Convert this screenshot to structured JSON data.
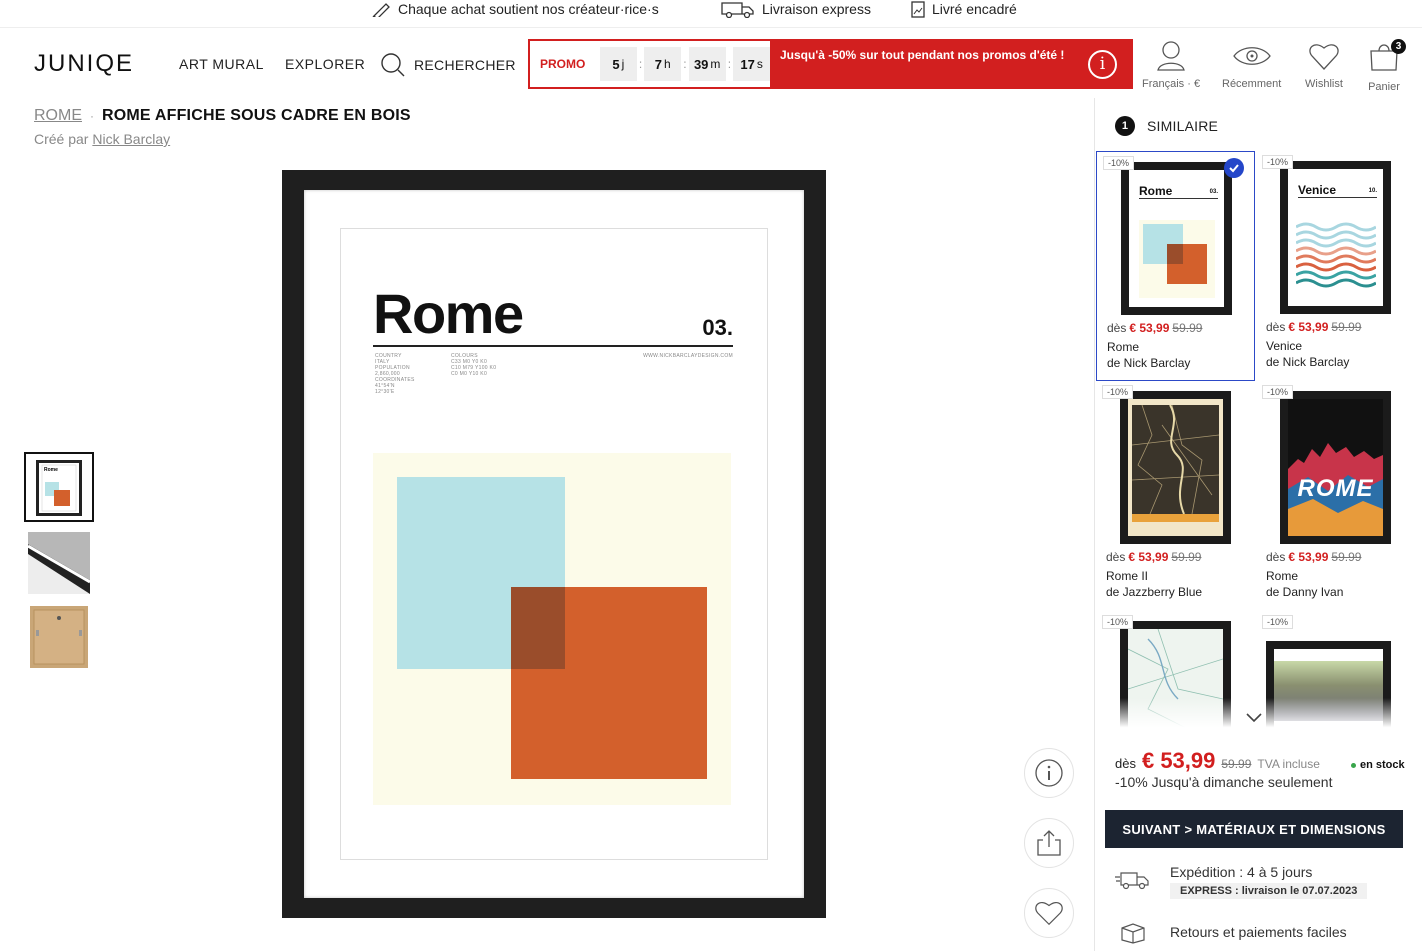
{
  "topbar": {
    "items": [
      "Chaque achat soutient nos créateur·rice·s",
      "Livraison express",
      "Livré encadré"
    ]
  },
  "header": {
    "logo": "JUNIQE",
    "nav": [
      "ART MURAL",
      "EXPLORER"
    ],
    "search_label": "RECHERCHER",
    "promo": {
      "label": "PROMO",
      "countdown": [
        {
          "value": "5",
          "unit": "j"
        },
        {
          "value": "7",
          "unit": "h"
        },
        {
          "value": "39",
          "unit": "m"
        },
        {
          "value": "17",
          "unit": "s"
        }
      ],
      "text": "Jusqu'à -50% sur tout pendant nos promos d'été !",
      "info_glyph": "i"
    },
    "icons": {
      "account_label": "Français · €",
      "recent_label": "Récemment",
      "wishlist_label": "Wishlist",
      "cart_label": "Panier",
      "cart_count": "3"
    }
  },
  "breadcrumb": {
    "parent": "ROME",
    "current": "ROME AFFICHE SOUS CADRE EN BOIS"
  },
  "creator": {
    "prefix": "Créé par",
    "name": "Nick Barclay"
  },
  "poster": {
    "title": "Rome",
    "number": "03.",
    "meta_left": [
      "COUNTRY",
      "ITALY",
      "POPULATION",
      "2,860,000",
      "COORDINATES",
      "41°54'N",
      "12°30'E"
    ],
    "meta_mid": [
      "COLOURS",
      "C33 M0 Y0 K0",
      "C10 M79 Y100 K0",
      "C0 M0 Y10 K0"
    ],
    "meta_right": "WWW.NICKBARCLAYDESIGN.COM"
  },
  "panel": {
    "step": "1",
    "heading": "SIMILAIRE",
    "products": [
      {
        "discount": "-10%",
        "from": "dès",
        "price": "€ 53,99",
        "old_price": "59.99",
        "name": "Rome",
        "artist": "de Nick Barclay",
        "selected": true,
        "poster_title": "Rome",
        "poster_num": "03."
      },
      {
        "discount": "-10%",
        "from": "dès",
        "price": "€ 53,99",
        "old_price": "59.99",
        "name": "Venice",
        "artist": "de Nick Barclay",
        "selected": false,
        "poster_title": "Venice",
        "poster_num": "10."
      },
      {
        "discount": "-10%",
        "from": "dès",
        "price": "€ 53,99",
        "old_price": "59.99",
        "name": "Rome II",
        "artist": "de Jazzberry Blue",
        "selected": false
      },
      {
        "discount": "-10%",
        "from": "dès",
        "price": "€ 53,99",
        "old_price": "59.99",
        "name": "Rome",
        "artist": "de Danny Ivan",
        "selected": false,
        "poster_title": "ROME"
      },
      {
        "discount": "-10%"
      },
      {
        "discount": "-10%"
      }
    ],
    "buy": {
      "from": "dès",
      "price": "€ 53,99",
      "old_price": "59.99",
      "vat": "TVA incluse",
      "stock": "en stock",
      "promo_note": "-10% Jusqu'à dimanche seulement",
      "cta": "SUIVANT > MATÉRIAUX ET DIMENSIONS",
      "shipping": "Expédition : 4 à 5 jours",
      "express": "EXPRESS : livraison le 07.07.2023",
      "returns": "Retours et paiements faciles"
    }
  },
  "colors": {
    "promo_red": "#d21f1f",
    "cta_navy": "#1c2431",
    "select_blue": "#2446c9",
    "poster_blue": "#b6e2e6",
    "poster_orange": "#d3602c",
    "poster_cream": "#fcfbe9"
  }
}
